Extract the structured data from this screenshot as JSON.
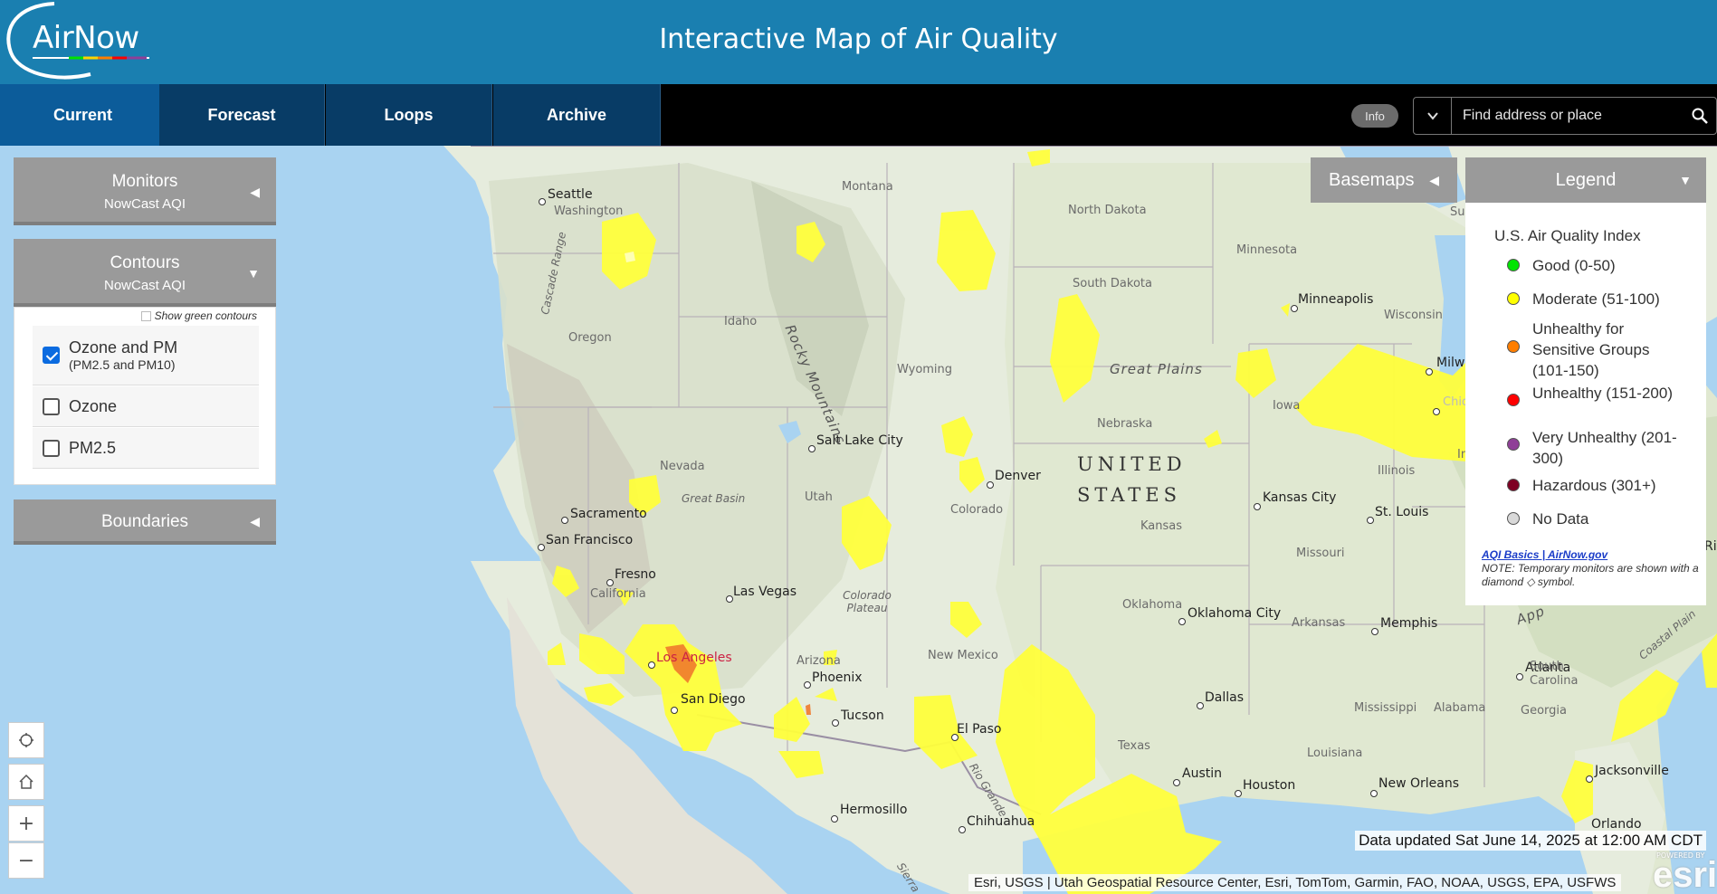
{
  "header": {
    "logo_text": "AirNow",
    "title": "Interactive Map of Air Quality"
  },
  "nav": {
    "tabs": [
      {
        "label": "Current",
        "active": true
      },
      {
        "label": "Forecast",
        "active": false
      },
      {
        "label": "Loops",
        "active": false
      },
      {
        "label": "Archive",
        "active": false
      }
    ],
    "info_label": "Info",
    "search_placeholder": "Find address or place"
  },
  "panels": {
    "monitors": {
      "title": "Monitors",
      "subtitle": "NowCast AQI"
    },
    "contours": {
      "title": "Contours",
      "subtitle": "NowCast AQI",
      "green_toggle": "Show green contours",
      "layers": [
        {
          "label": "Ozone and PM",
          "sublabel": "(PM2.5 and PM10)",
          "checked": true
        },
        {
          "label": "Ozone",
          "checked": false
        },
        {
          "label": "PM2.5",
          "checked": false
        }
      ]
    },
    "boundaries": {
      "title": "Boundaries"
    }
  },
  "basemaps_label": "Basemaps",
  "legend": {
    "header": "Legend",
    "title": "U.S. Air Quality Index",
    "items": [
      {
        "label": "Good (0-50)",
        "color": "#00e400"
      },
      {
        "label": "Moderate (51-100)",
        "color": "#ffff00"
      },
      {
        "label": "Unhealthy for Sensitive Groups (101-150)",
        "color": "#ff7e00"
      },
      {
        "label": "Unhealthy (151-200)",
        "color": "#ff0000"
      },
      {
        "label": "Very Unhealthy (201-300)",
        "color": "#8f3f97"
      },
      {
        "label": "Hazardous (301+)",
        "color": "#7e0023"
      },
      {
        "label": "No Data",
        "color": "#d9d9d9"
      }
    ],
    "link": "AQI Basics | AirNow.gov",
    "note": "NOTE: Temporary monitors are shown with a diamond ◇ symbol."
  },
  "map": {
    "cities": [
      "Seattle",
      "Sacramento",
      "San Francisco",
      "Fresno",
      "Los Angeles",
      "San Diego",
      "Las Vegas",
      "Phoenix",
      "Tucson",
      "Hermosillo",
      "Salt Lake City",
      "Denver",
      "El Paso",
      "Chihuahua",
      "Minneapolis",
      "Milw",
      "Kansas City",
      "St. Louis",
      "Oklahoma City",
      "Memphis",
      "Dallas",
      "Austin",
      "Houston",
      "New Orleans",
      "Atlanta",
      "Jacksonville",
      "Orlando",
      "Chic",
      "Ric"
    ],
    "states": [
      "Washington",
      "Oregon",
      "Idaho",
      "Montana",
      "Wyoming",
      "North Dakota",
      "South Dakota",
      "Nebraska",
      "Kansas",
      "Missouri",
      "Iowa",
      "Illinois",
      "Minnesota",
      "Wisconsin",
      "Oklahoma",
      "Arkansas",
      "Texas",
      "New Mexico",
      "Arizona",
      "Colorado",
      "Utah",
      "Nevada",
      "California",
      "Mississippi",
      "Alabama",
      "Georgia",
      "Louisiana",
      "South Carolina",
      "In",
      "Su"
    ],
    "features": [
      "Great Plains",
      "Rocky Mountains",
      "Great Basin",
      "Colorado Plateau",
      "Cascade Range",
      "Rio Grande",
      "Sierra",
      "Coastal Plain",
      "App"
    ],
    "country": "UNITED STATES"
  },
  "data_updated": "Data updated Sat June 14, 2025 at 12:00 AM CDT",
  "attribution": "Esri, USGS | Utah Geospatial Resource Center, Esri, TomTom, Garmin, FAO, NOAA, USGS, EPA, USFWS",
  "esri_logo": "esri",
  "esri_powered": "POWERED BY"
}
